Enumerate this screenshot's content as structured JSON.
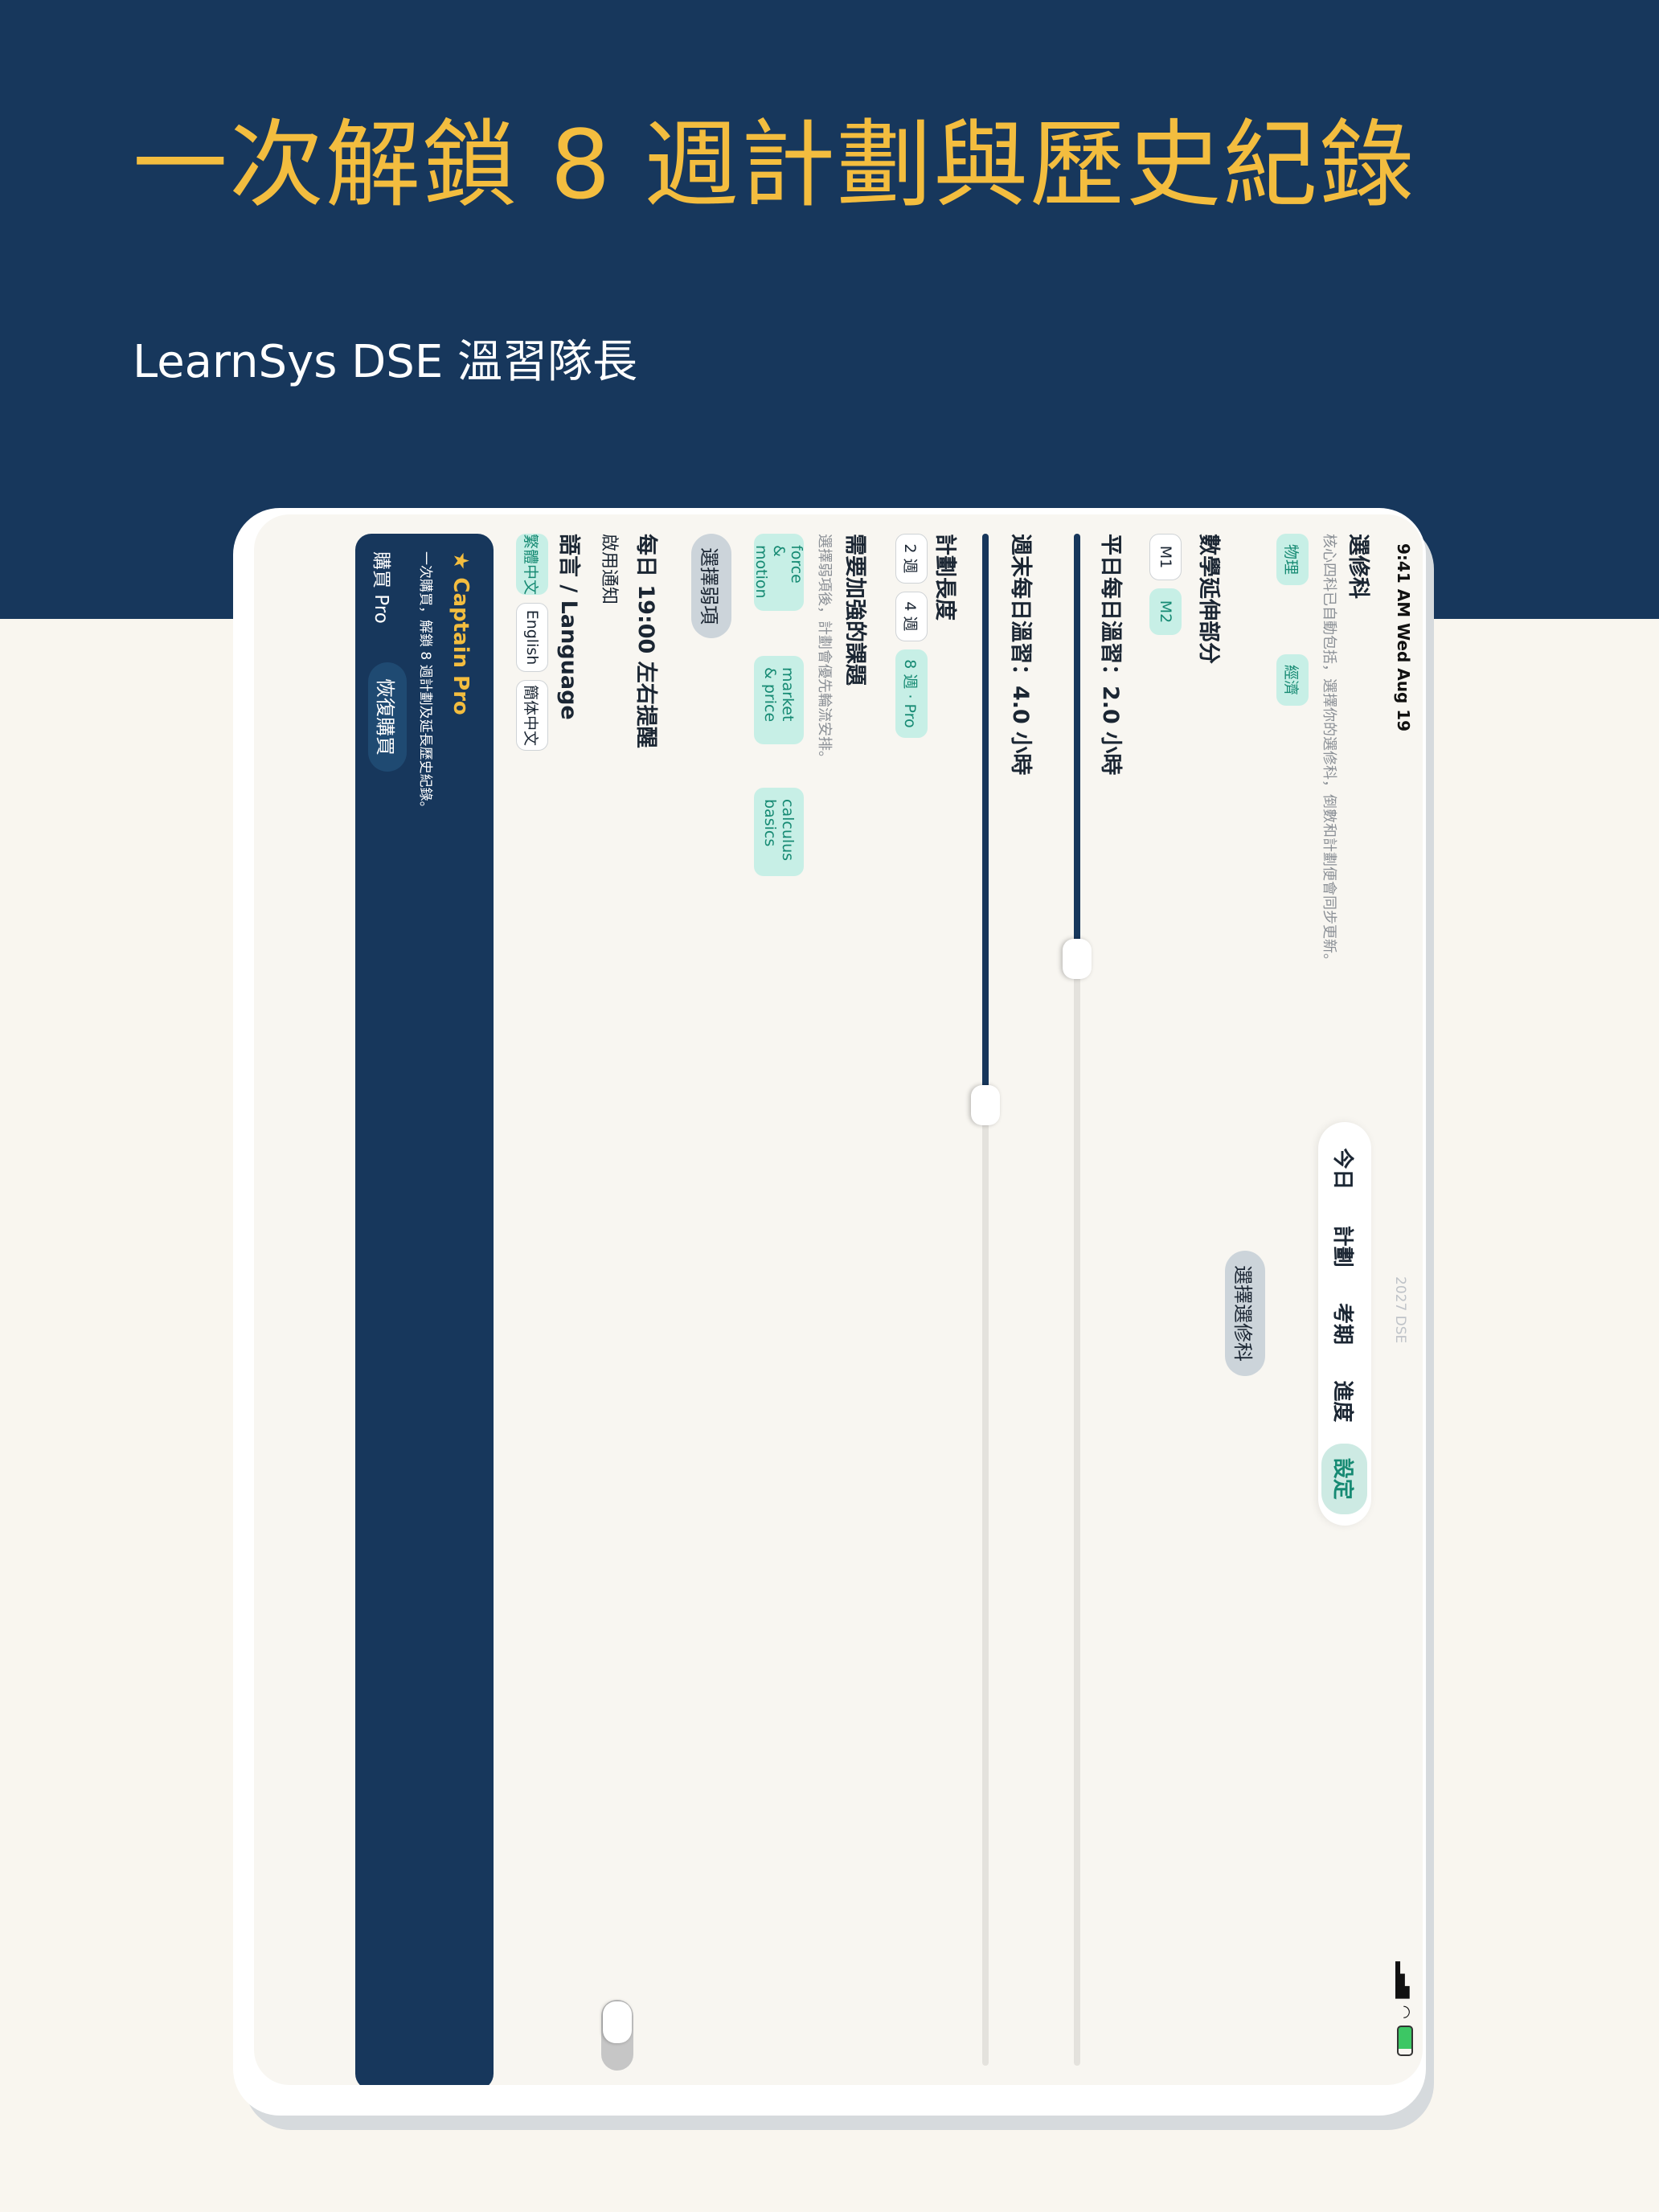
{
  "headline": "一次解鎖 8 週計劃與歷史紀錄",
  "subline": "LearnSys DSE 溫習隊長",
  "status": {
    "time": "9:41 AM  Wed Aug 19"
  },
  "exam_label": "2027 DSE",
  "nav": {
    "tabs": [
      "今日",
      "計劃",
      "考期",
      "進度",
      "設定"
    ],
    "active": "設定"
  },
  "electives": {
    "title": "選修科",
    "note": "核心四科已自動包括，選擇你的選修科，倒數和計劃便會同步更新。",
    "chips": [
      "物理",
      "經濟"
    ],
    "button": "選擇選修科"
  },
  "math_ext": {
    "title": "數學延伸部分",
    "options": [
      "M1",
      "M2"
    ],
    "selected": "M2"
  },
  "weekday": {
    "label": "平日每日溫習：2.0 小時",
    "value_hours": 2.0,
    "max_hours": 6,
    "fill_ratio": 0.28
  },
  "weekend": {
    "label": "週末每日溫習：4.0 小時",
    "value_hours": 4.0,
    "max_hours": 8,
    "fill_ratio": 0.37
  },
  "plan_length": {
    "title": "計劃長度",
    "options": [
      "2 週",
      "4 週",
      "8 週 · Pro"
    ],
    "selected": "8 週 · Pro"
  },
  "weak_topics": {
    "title": "需要加強的課題",
    "note": "選擇弱項後，計劃會優先輪流安排。",
    "topics": [
      "force & motion",
      "market & price",
      "calculus basics"
    ],
    "button": "選擇弱項"
  },
  "reminder": {
    "title": "每日 19:00 左右提醒",
    "subtitle": "啟用通知",
    "enabled": false
  },
  "language": {
    "title": "語言 / Language",
    "options": [
      "繁體中文",
      "English",
      "簡体中文"
    ],
    "selected": "繁體中文"
  },
  "pro": {
    "title": "★ Captain Pro",
    "desc": "一次購買，解鎖 8 週計劃及延長歷史紀錄。",
    "buy": "購買 Pro",
    "restore": "恢復購買"
  }
}
